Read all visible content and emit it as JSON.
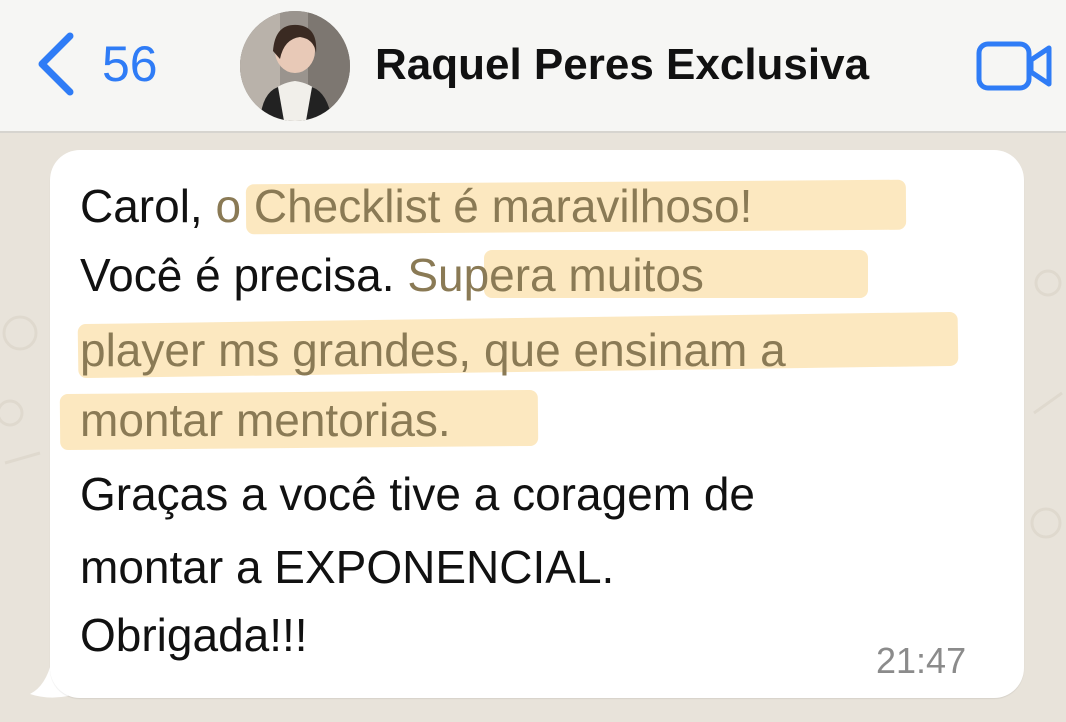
{
  "header": {
    "back_count": "56",
    "contact_name": "Raquel Peres Exclusiva",
    "back_icon": "chevron-left-icon",
    "video_icon": "video-camera-icon"
  },
  "message": {
    "line1_a": "Carol, ",
    "line1_b": "o Checklist é maravilhoso!",
    "line2_a": "Você é precisa. ",
    "line2_b": "Supera muitos",
    "line3": "player ms grandes, que ensinam a",
    "line4": "montar mentorias.",
    "line5": "Graças a você tive a coragem de",
    "line6": "montar a EXPONENCIAL.",
    "line7": "Obrigada!!!",
    "time": "21:47"
  },
  "colors": {
    "accent": "#2f7cf6",
    "highlight": "#fbe4b5",
    "highlighted_text": "#8a7a55",
    "timestamp": "#8b8b8b"
  }
}
